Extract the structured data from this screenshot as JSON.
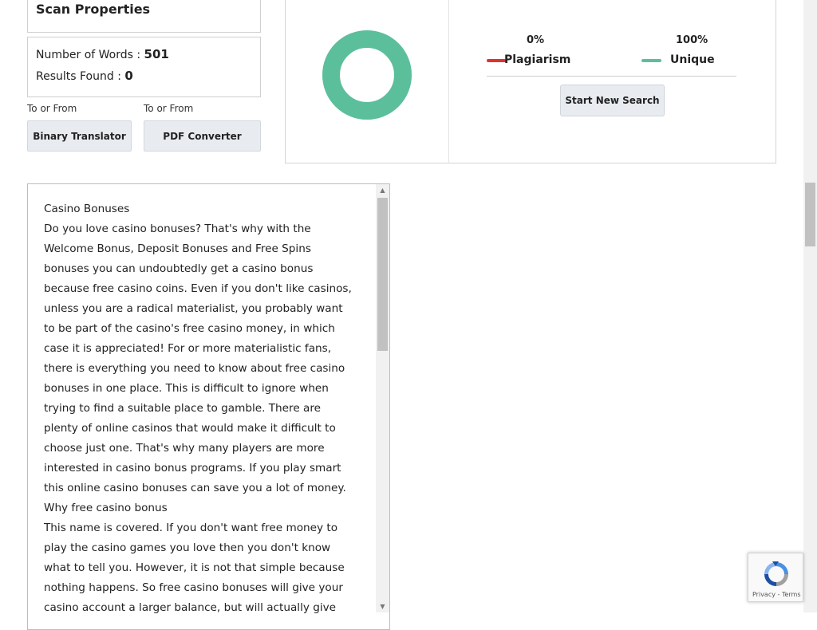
{
  "scan_properties": {
    "title": "Scan Properties",
    "words_label": "Number of Words :",
    "words_value": "501",
    "results_label": "Results Found :",
    "results_value": "0"
  },
  "tools": [
    {
      "caption": "To or From",
      "button_label": "Binary Translator"
    },
    {
      "caption": "To or From",
      "button_label": "PDF Converter"
    }
  ],
  "result": {
    "plagiarism_percent": "0%",
    "plagiarism_label": "Plagiarism",
    "unique_percent": "100%",
    "unique_label": "Unique",
    "donut_unique_fraction": 1.0,
    "start_button_label": "Start New Search",
    "colors": {
      "unique": "#5bbf9b",
      "plagiarism": "#e03131"
    }
  },
  "text_lines": [
    "Casino Bonuses",
    "Do you love casino bonuses? That's why with the",
    "Welcome Bonus, Deposit Bonuses and Free Spins",
    "bonuses you can undoubtedly get a casino bonus",
    "because free casino coins. Even if you don't like casinos,",
    "unless you are a radical materialist, you probably want",
    "to be part of the casino's free casino money, in which",
    "case it is appreciated! For or more materialistic fans,",
    "there is everything you need to know about free casino",
    "bonuses in one place. This is difficult to ignore when",
    "trying to find a suitable place to gamble. There are",
    "plenty of online casinos that would make it difficult to",
    "choose just one. That's why many players are more",
    "interested in casino bonus programs. If you play smart",
    "this online casino bonuses can save you a lot of money.",
    "Why free casino bonus",
    "This name is covered. If you don't want free money to",
    "play the casino games you love then you don't know",
    "what to tell you. However, it is not that simple because",
    "nothing happens. So free casino bonuses will give your",
    "casino account a larger balance, but will actually give"
  ],
  "recaptcha": {
    "links": "Privacy - Terms"
  }
}
